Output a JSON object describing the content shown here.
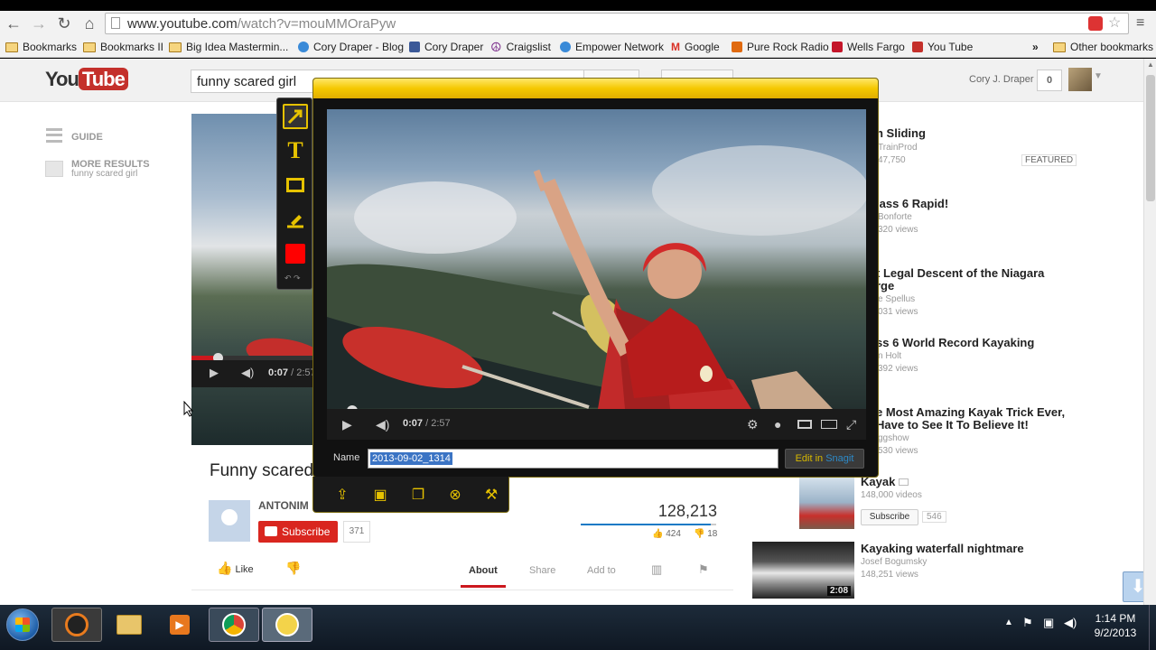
{
  "browser": {
    "url_host": "www.youtube.com",
    "url_path": "/watch?v=mouMMOraPyw",
    "bookmarks": [
      "Bookmarks",
      "Bookmarks II",
      "Big Idea Mastermin...",
      "Cory Draper - Blog",
      "Cory Draper",
      "Craigslist",
      "Empower Network",
      "Google",
      "Pure Rock Radio",
      "Wells Fargo",
      "You Tube"
    ],
    "overflow": "»",
    "other_bookmarks": "Other bookmarks"
  },
  "youtube": {
    "logo_you": "You",
    "logo_tube": "Tube",
    "search_query": "funny scared girl",
    "user_name": "Cory J. Draper",
    "notifications": "0",
    "guide_label": "GUIDE",
    "more_results": "MORE RESULTS",
    "more_results_query": "funny scared girl",
    "video_title": "Funny scared",
    "channel": "ANTONIM",
    "subscribe": "Subscribe",
    "subscribers": "371",
    "view_count": "128,213",
    "likes": "424",
    "dislikes": "18",
    "like_label": "Like",
    "tabs": [
      "About",
      "Share",
      "Add to"
    ],
    "player_time": "0:07",
    "player_duration": "/ 2:57",
    "featured": "FEATURED"
  },
  "related": [
    {
      "title": "n Sliding",
      "meta1": "TrainProd",
      "meta2": "47,750"
    },
    {
      "title": "lass 6 Rapid!",
      "meta1": "Bonforte",
      "meta2": "320 views"
    },
    {
      "title": "t Legal Descent of the Niagara",
      "title2": "rge",
      "meta1": "e Spellus",
      "meta2": "031 views"
    },
    {
      "title": "ss 6 World Record Kayaking",
      "meta1": "n Holt",
      "meta2": "392 views"
    },
    {
      "title": "e Most Amazing Kayak Trick Ever,",
      "title2": "Have to See It To Believe It!",
      "meta1": "ggshow",
      "meta2": "530 views"
    },
    {
      "title": "Kayak",
      "meta1": "148,000 videos",
      "subscribe": "Subscribe",
      "count": "546"
    },
    {
      "title": "Kayaking waterfall nightmare",
      "meta1": "Josef Bogumsky",
      "meta2": "148,251 views",
      "duration": "2:08"
    }
  ],
  "snagit": {
    "time": "0:07",
    "duration": "/ 2:57",
    "name_label": "Name",
    "name_value": "2013-09-02_1314",
    "edit_prefix": "Edit in ",
    "edit_app": "Snagit"
  },
  "taskbar": {
    "time": "1:14 PM",
    "date": "9/2/2013"
  }
}
